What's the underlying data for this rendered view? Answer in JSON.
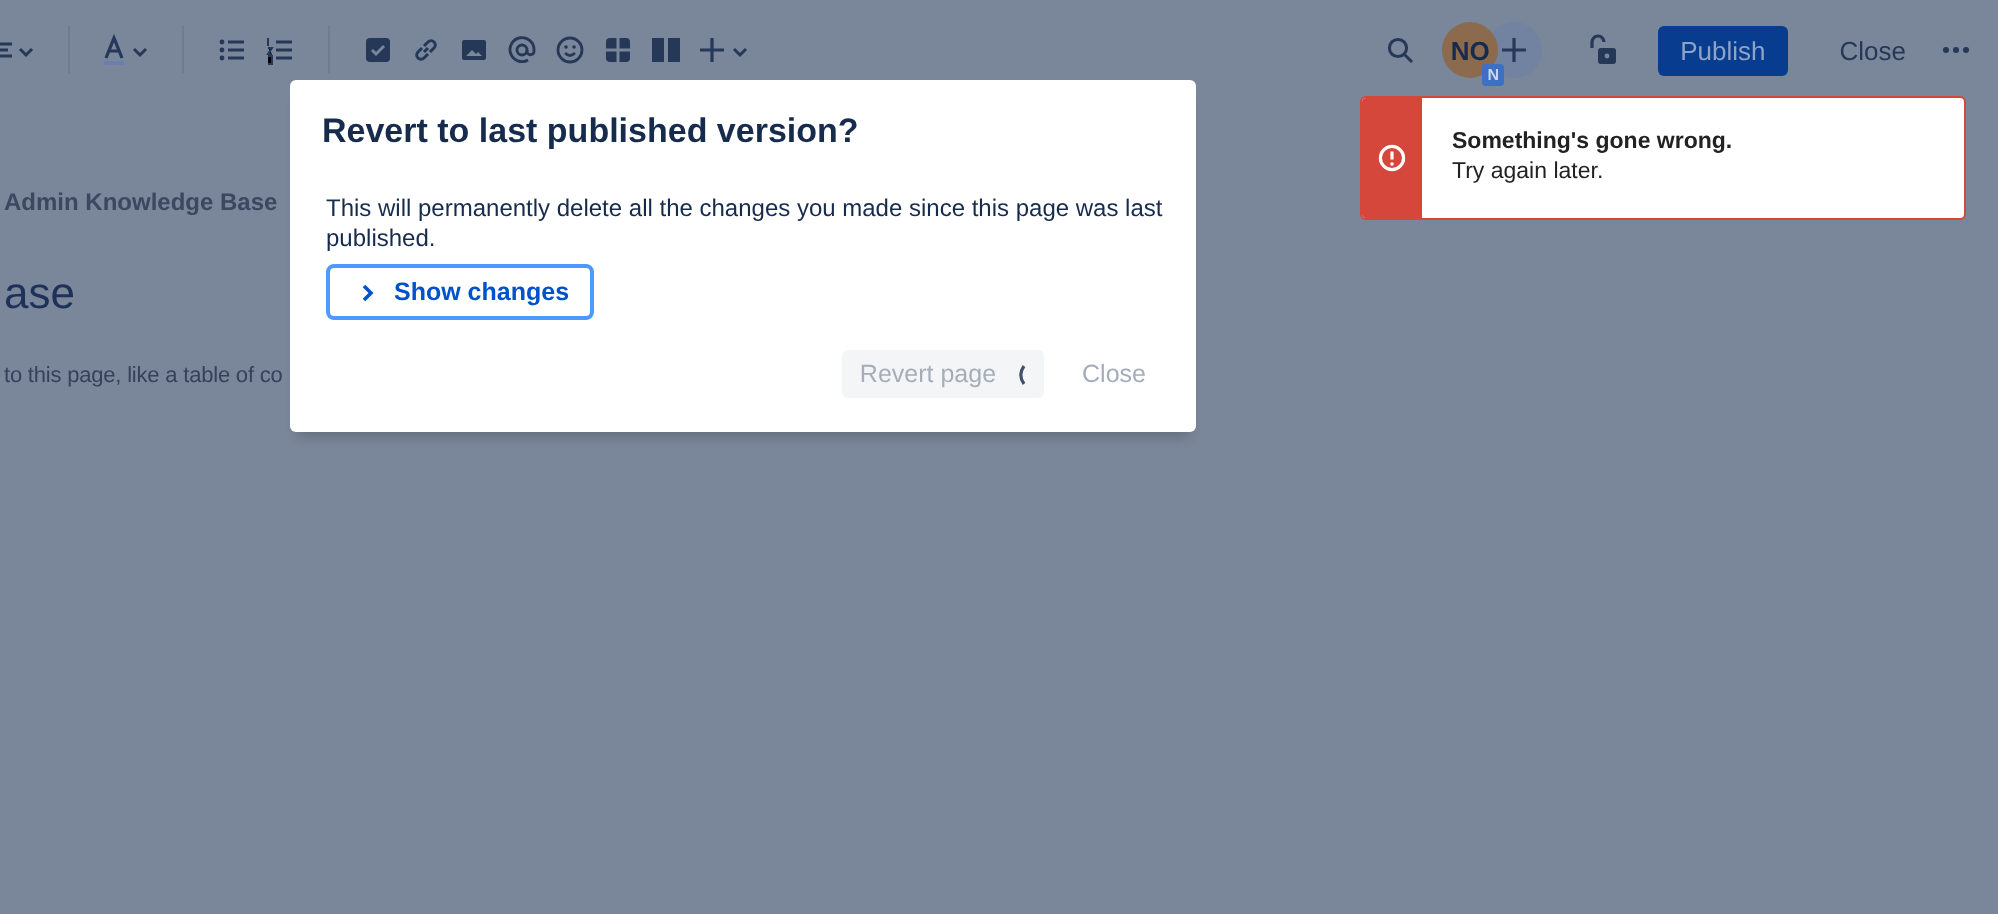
{
  "header": {
    "avatar": {
      "initials": "NO",
      "badge": "N"
    },
    "publish_button": "Publish",
    "close_button": "Close"
  },
  "page": {
    "breadcrumb": "Admin Knowledge Base",
    "title": "ase",
    "placeholder": "to this page, like a table of co"
  },
  "dialog": {
    "title": "Revert to last published version?",
    "message": "This will permanently delete all the changes you made since this page was last published.",
    "show_changes": {
      "label": "Show changes",
      "expanded": false
    },
    "buttons": [
      {
        "label": "Revert page",
        "kind": "primary",
        "disabled": true,
        "loading": true
      },
      {
        "label": "Close",
        "kind": "subtle",
        "disabled": true,
        "loading": false
      }
    ]
  },
  "toast": {
    "kind": "error",
    "title": "Something's gone wrong.",
    "message": "Try again later."
  }
}
